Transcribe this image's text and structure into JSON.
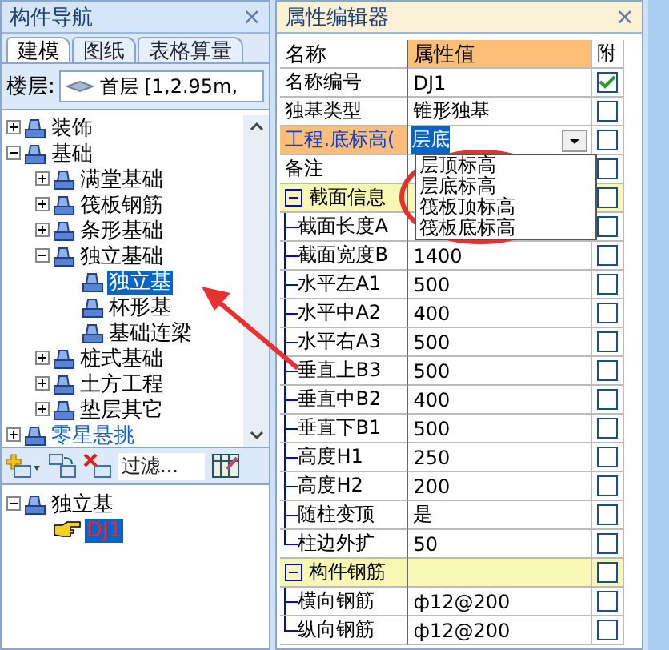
{
  "navigator": {
    "title": "构件导航",
    "close": "×",
    "tabs": [
      {
        "label": "建模",
        "selected": true
      },
      {
        "label": "图纸",
        "selected": false
      },
      {
        "label": "表格算量",
        "selected": false
      }
    ],
    "floor": {
      "label": "楼层:",
      "value": "首层 [1,2.95m,"
    },
    "tree": [
      {
        "label": "装饰",
        "expanded": false,
        "selected": false
      },
      {
        "label": "基础",
        "expanded": true,
        "selected": false,
        "children": [
          {
            "label": "满堂基础",
            "expanded": false,
            "selected": false
          },
          {
            "label": "筏板钢筋",
            "expanded": false,
            "selected": false
          },
          {
            "label": "条形基础",
            "expanded": false,
            "selected": false
          },
          {
            "label": "独立基础",
            "expanded": true,
            "selected": false,
            "children": [
              {
                "label": "独立基",
                "selected": true
              },
              {
                "label": "杯形基",
                "selected": false
              },
              {
                "label": "基础连梁",
                "selected": false
              }
            ]
          },
          {
            "label": "桩式基础",
            "expanded": false,
            "selected": false
          },
          {
            "label": "土方工程",
            "expanded": false,
            "selected": false
          },
          {
            "label": "垫层其它",
            "expanded": false,
            "selected": false
          }
        ]
      },
      {
        "label": "零星悬挑",
        "expanded": false,
        "selected": false,
        "highlight": true
      }
    ],
    "filter": {
      "placeholder": "过滤..."
    },
    "components": [
      {
        "label": "独立基",
        "expanded": true,
        "children": [
          {
            "label": "DJ1",
            "selected": true
          }
        ]
      }
    ]
  },
  "editor": {
    "title": "属性编辑器",
    "close": "×",
    "columns": [
      "名称",
      "属性值",
      "附"
    ],
    "rows": [
      {
        "kind": "prop",
        "name": "名称编号",
        "value": "DJ1",
        "checked": true
      },
      {
        "kind": "prop",
        "name": "独基类型",
        "value": "锥形独基",
        "checked": false
      },
      {
        "kind": "combo",
        "name": "工程.底标高(",
        "value": "层底",
        "checked": false
      },
      {
        "kind": "prop",
        "name": "备注",
        "checked": false
      },
      {
        "kind": "group",
        "name": "截面信息",
        "checked": false
      },
      {
        "kind": "child",
        "name": "截面长度A",
        "checked": false
      },
      {
        "kind": "child",
        "name": "截面宽度B",
        "value": "1400",
        "checked": false
      },
      {
        "kind": "child",
        "name": "水平左A1",
        "value": "500",
        "checked": false
      },
      {
        "kind": "child",
        "name": "水平中A2",
        "value": "400",
        "checked": false
      },
      {
        "kind": "child",
        "name": "水平右A3",
        "value": "500",
        "checked": false
      },
      {
        "kind": "child",
        "name": "垂直上B3",
        "value": "500",
        "checked": false
      },
      {
        "kind": "child",
        "name": "垂直中B2",
        "value": "400",
        "checked": false
      },
      {
        "kind": "child",
        "name": "垂直下B1",
        "value": "500",
        "checked": false
      },
      {
        "kind": "child",
        "name": "高度H1",
        "value": "250",
        "checked": false
      },
      {
        "kind": "child",
        "name": "高度H2",
        "value": "200",
        "checked": false
      },
      {
        "kind": "child",
        "name": "随柱变顶",
        "value": "是",
        "checked": false
      },
      {
        "kind": "child",
        "name": "柱边外扩",
        "value": "50",
        "checked": false
      },
      {
        "kind": "group",
        "name": "构件钢筋",
        "checked": false
      },
      {
        "kind": "child",
        "name": "横向钢筋",
        "value": "ф12@200",
        "checked": false
      },
      {
        "kind": "child",
        "name": "纵向钢筋",
        "value": "ф12@200",
        "checked": false
      }
    ],
    "dropdown": [
      "层顶标高",
      "层底标高",
      "筏板顶标高",
      "筏板底标高"
    ]
  }
}
